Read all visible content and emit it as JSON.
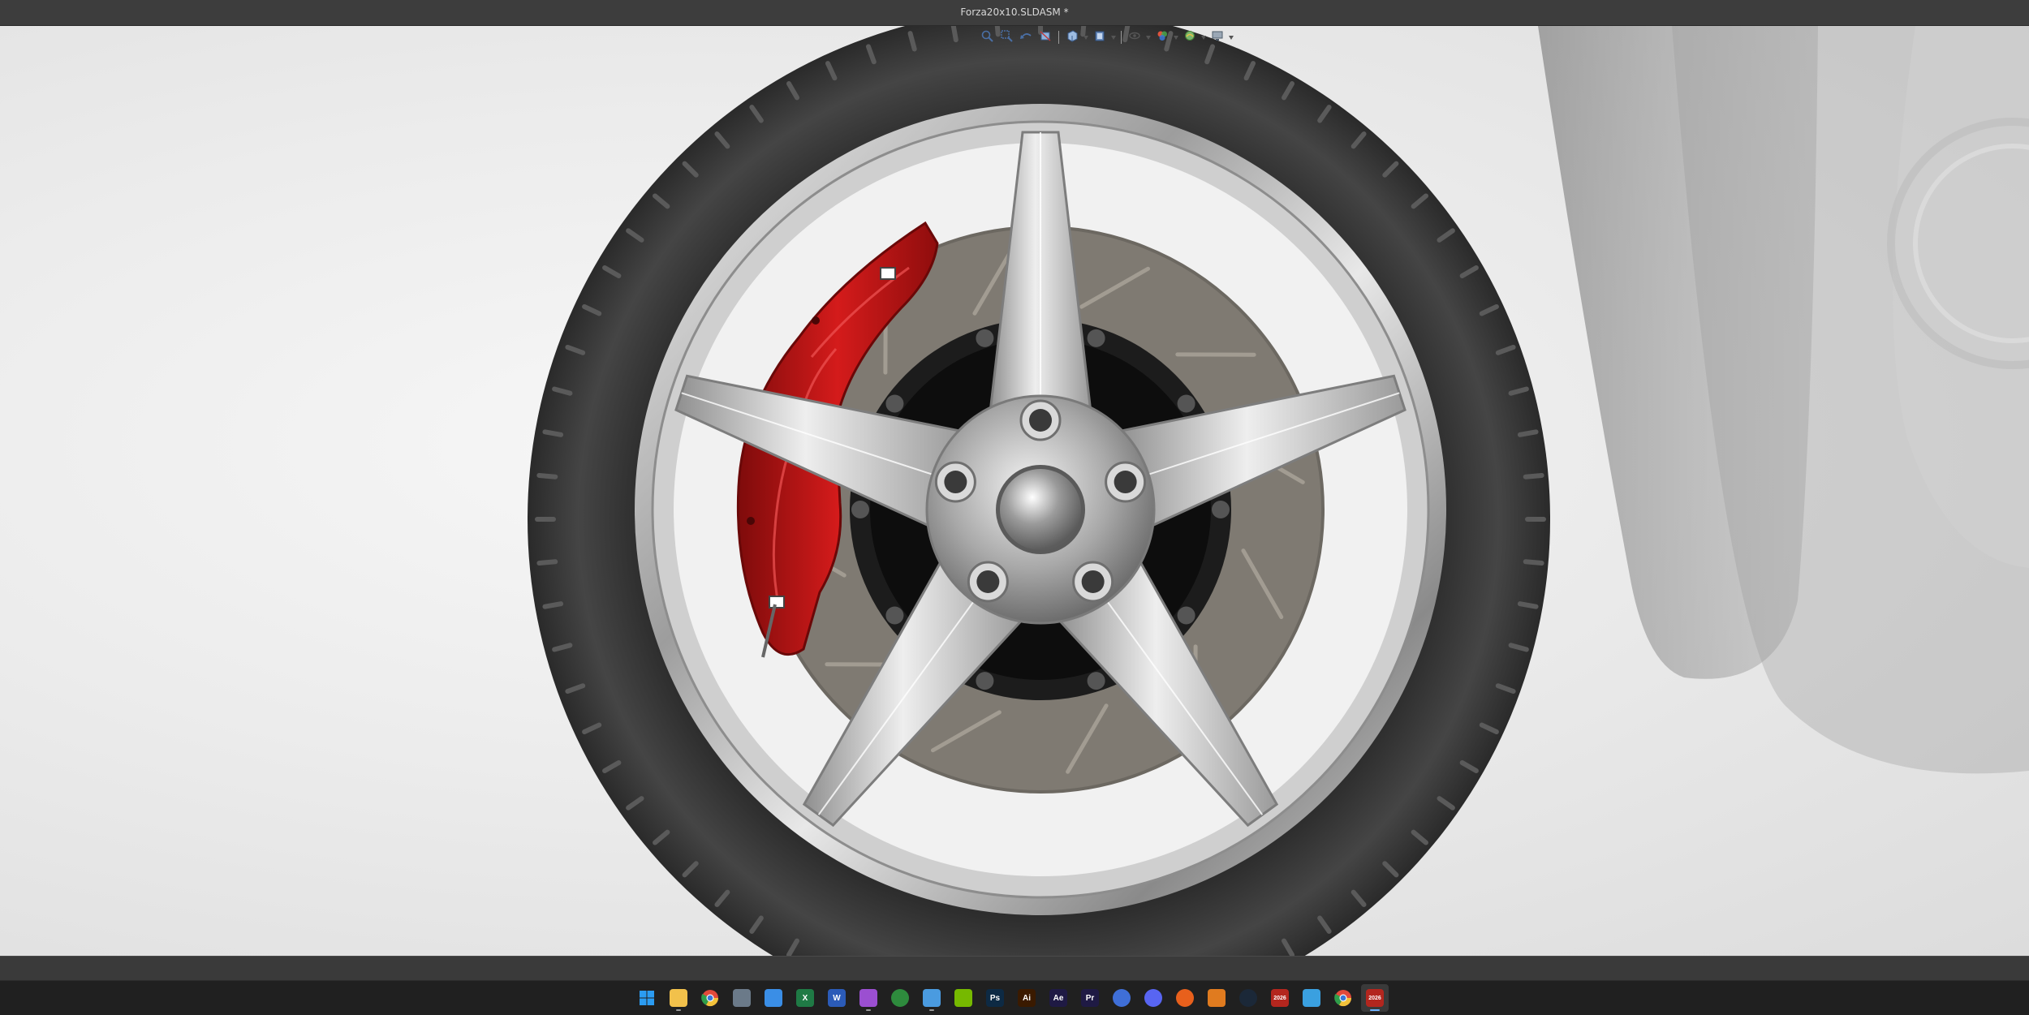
{
  "window": {
    "title": "Forza20x10.SLDASM *"
  },
  "colors": {
    "caliper": "#c01414",
    "tire": "#3b3b3b",
    "rim": "#cfcfcf",
    "rotor": "#7f7a72",
    "viewport_bg": "#ececec",
    "taskbar_bg": "#202020"
  },
  "heads_up_toolbar": [
    {
      "name": "zoom-to-fit",
      "icon": "zoom-to-fit-icon",
      "dropdown": false
    },
    {
      "name": "zoom-to-area",
      "icon": "zoom-to-area-icon",
      "dropdown": false
    },
    {
      "name": "previous-view",
      "icon": "previous-view-icon",
      "dropdown": false
    },
    {
      "name": "section-view",
      "icon": "section-view-icon",
      "dropdown": false
    },
    {
      "name": "view-orientation",
      "icon": "view-orientation-icon",
      "dropdown": true
    },
    {
      "name": "display-style",
      "icon": "display-style-icon",
      "dropdown": true
    },
    {
      "name": "hide-show-items",
      "icon": "hide-show-eye-icon",
      "dropdown": true
    },
    {
      "name": "edit-appearance",
      "icon": "edit-appearance-icon",
      "dropdown": true
    },
    {
      "name": "apply-scene",
      "icon": "apply-scene-icon",
      "dropdown": true
    },
    {
      "name": "view-settings",
      "icon": "monitor-icon",
      "dropdown": true
    }
  ],
  "taskbar": [
    {
      "name": "start",
      "icon": "windows-start-icon",
      "label": "",
      "color": "#2b9cf2",
      "active": false,
      "running": false
    },
    {
      "name": "file-explorer",
      "icon": "folder-icon",
      "label": "",
      "color": "#f2c14b",
      "active": false,
      "running": true
    },
    {
      "name": "chrome",
      "icon": "chrome-icon",
      "label": "",
      "color": "#e24a3b",
      "active": false,
      "running": false
    },
    {
      "name": "calculator",
      "icon": "calculator-icon",
      "label": "",
      "color": "#6b7a89",
      "active": false,
      "running": false
    },
    {
      "name": "microsoft-store",
      "icon": "store-icon",
      "label": "",
      "color": "#3a8ee6",
      "active": false,
      "running": false
    },
    {
      "name": "excel",
      "icon": "excel-icon",
      "label": "X",
      "color": "#1f7a45",
      "active": false,
      "running": false
    },
    {
      "name": "word",
      "icon": "word-icon",
      "label": "W",
      "color": "#2b5bb8",
      "active": false,
      "running": false
    },
    {
      "name": "snipping-tool",
      "icon": "snipping-tool-icon",
      "label": "",
      "color": "#9b4fd1",
      "active": false,
      "running": true
    },
    {
      "name": "xbox",
      "icon": "xbox-icon",
      "label": "",
      "color": "#2e8b3d",
      "active": false,
      "running": false
    },
    {
      "name": "phone-link",
      "icon": "phone-icon",
      "label": "",
      "color": "#4a9be0",
      "active": false,
      "running": true
    },
    {
      "name": "nvidia",
      "icon": "nvidia-icon",
      "label": "",
      "color": "#76b900",
      "active": false,
      "running": false
    },
    {
      "name": "photoshop",
      "icon": "photoshop-icon",
      "label": "Ps",
      "color": "#0d2a44",
      "active": false,
      "running": false
    },
    {
      "name": "illustrator",
      "icon": "illustrator-icon",
      "label": "Ai",
      "color": "#3a1a00",
      "active": false,
      "running": false
    },
    {
      "name": "after-effects",
      "icon": "after-effects-icon",
      "label": "Ae",
      "color": "#1f1a44",
      "active": false,
      "running": false
    },
    {
      "name": "premiere",
      "icon": "premiere-icon",
      "label": "Pr",
      "color": "#1f1a44",
      "active": false,
      "running": false
    },
    {
      "name": "mail",
      "icon": "mail-icon",
      "label": "",
      "color": "#3f6fd8",
      "active": false,
      "running": false
    },
    {
      "name": "discord",
      "icon": "discord-icon",
      "label": "",
      "color": "#5865f2",
      "active": false,
      "running": false
    },
    {
      "name": "game-launcher",
      "icon": "orange-game-icon",
      "label": "",
      "color": "#e8601c",
      "active": false,
      "running": false
    },
    {
      "name": "forza-app",
      "icon": "forza-icon",
      "label": "",
      "color": "#e07b1f",
      "active": false,
      "running": false
    },
    {
      "name": "steam",
      "icon": "steam-icon",
      "label": "",
      "color": "#1b2838",
      "active": false,
      "running": false
    },
    {
      "name": "solidworks-2026-a",
      "icon": "solidworks-icon",
      "label": "2026",
      "color": "#b3261e",
      "active": false,
      "running": false
    },
    {
      "name": "3d-viewer",
      "icon": "cube-icon",
      "label": "",
      "color": "#3aa0e0",
      "active": false,
      "running": false
    },
    {
      "name": "chrome-profile",
      "icon": "chrome-icon",
      "label": "",
      "color": "#e24a3b",
      "active": false,
      "running": false
    },
    {
      "name": "solidworks-2026-b",
      "icon": "solidworks-icon",
      "label": "2026",
      "color": "#b3261e",
      "active": true,
      "running": true
    }
  ]
}
